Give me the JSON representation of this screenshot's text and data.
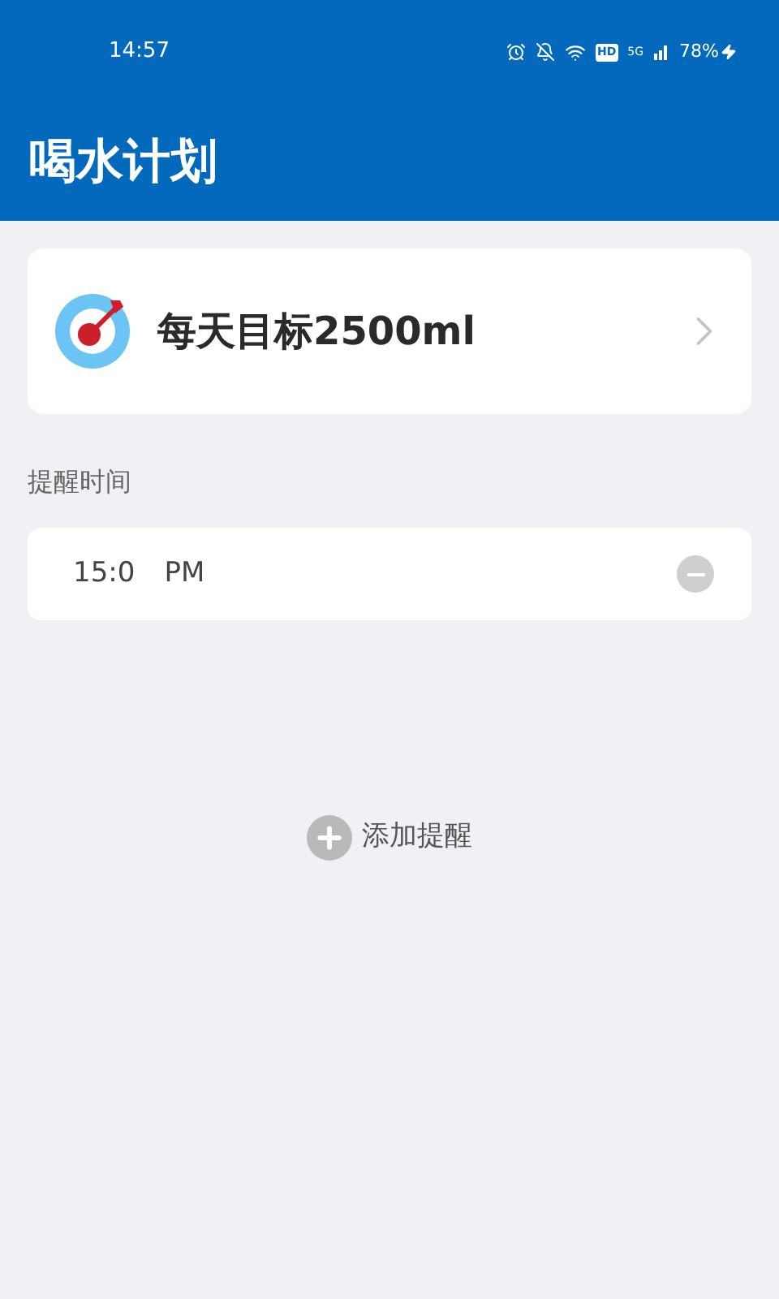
{
  "status_bar": {
    "time": "14:57",
    "hd": "HD",
    "network": "5G",
    "battery": "78%"
  },
  "app_bar": {
    "title": "喝水计划"
  },
  "goal_card": {
    "label": "每天目标2500ml"
  },
  "reminders": {
    "heading": "提醒时间",
    "items": [
      {
        "time": "15:0",
        "period": "PM"
      }
    ]
  },
  "add_button": {
    "label": "添加提醒"
  }
}
